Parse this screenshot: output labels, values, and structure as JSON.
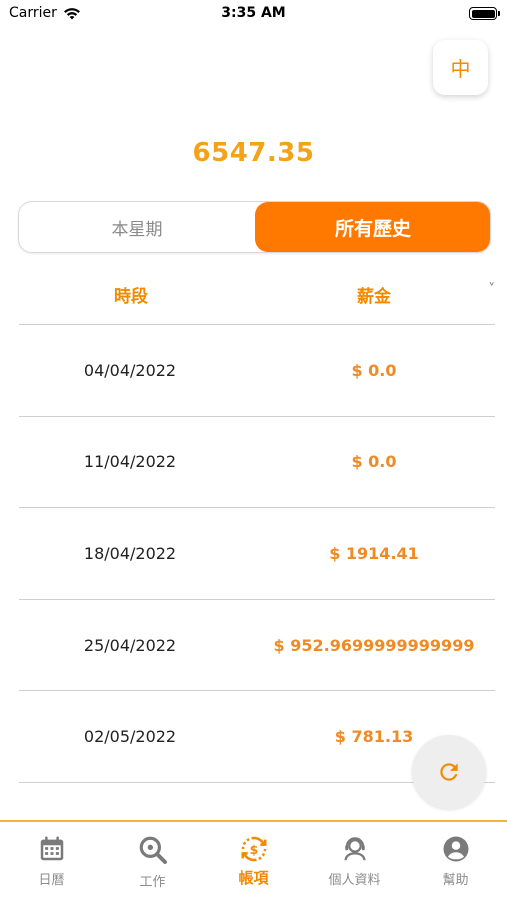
{
  "status_bar": {
    "carrier": "Carrier",
    "time": "3:35 AM"
  },
  "language_button": {
    "label": "中"
  },
  "total_amount": "6547.35",
  "segment": {
    "this_week": "本星期",
    "all_history": "所有歷史",
    "selected": "all_history"
  },
  "table": {
    "headers": {
      "period": "時段",
      "salary": "薪金"
    },
    "rows": [
      {
        "date": "04/04/2022",
        "amount": "$ 0.0"
      },
      {
        "date": "11/04/2022",
        "amount": "$ 0.0"
      },
      {
        "date": "18/04/2022",
        "amount": "$ 1914.41"
      },
      {
        "date": "25/04/2022",
        "amount": "$ 952.9699999999999"
      },
      {
        "date": "02/05/2022",
        "amount": "$ 781.13"
      }
    ]
  },
  "tabs": [
    {
      "label": "日曆",
      "icon": "calendar-icon",
      "active": false
    },
    {
      "label": "工作",
      "icon": "search-icon",
      "active": false
    },
    {
      "label": "帳項",
      "icon": "dollar-cycle-icon",
      "active": true
    },
    {
      "label": "個人資料",
      "icon": "support-agent-icon",
      "active": false
    },
    {
      "label": "幫助",
      "icon": "account-circle-icon",
      "active": false
    }
  ],
  "colors": {
    "accent": "#ff7900",
    "amount": "#f08a24",
    "total": "#f4a21a",
    "tab_border": "#f6b13a"
  }
}
